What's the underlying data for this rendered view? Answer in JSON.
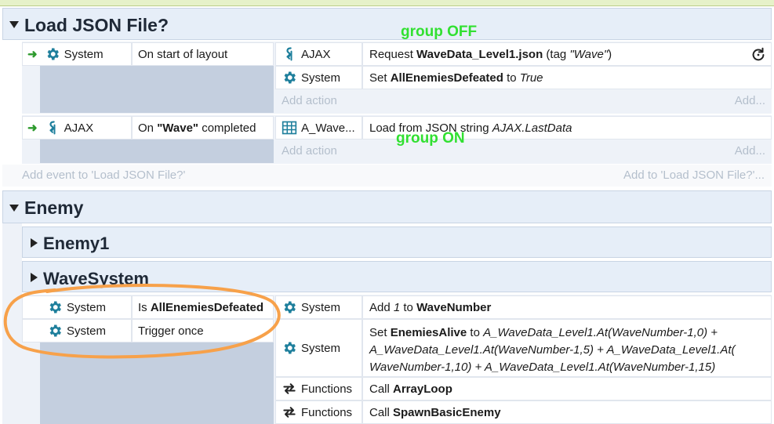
{
  "groups": {
    "load_json": {
      "title": "Load JSON File?",
      "event1": {
        "condition": {
          "object": "System",
          "text": "On start of layout"
        },
        "actions": [
          {
            "object": "AJAX",
            "prefix": "Request ",
            "bold": "WaveData_Level1.json",
            "mid": " (tag ",
            "italic": "\"Wave\"",
            "suffix": ")"
          },
          {
            "object": "System",
            "prefix": "Set ",
            "bold": "AllEnemiesDefeated",
            "mid": " to ",
            "italic": "True"
          }
        ],
        "add_action": "Add action",
        "add_short": "Add..."
      },
      "event2": {
        "condition": {
          "object": "AJAX",
          "prefix": "On ",
          "bold": "\"Wave\"",
          "suffix": " completed"
        },
        "actions": [
          {
            "object": "A_Wave...",
            "prefix": "Load from JSON string ",
            "italic": "AJAX.LastData"
          }
        ],
        "add_action": "Add action",
        "add_short": "Add..."
      },
      "add_event": "Add event to 'Load JSON File?'",
      "add_to": "Add to 'Load JSON File?'..."
    },
    "enemy": {
      "title": "Enemy",
      "sub1": "Enemy1",
      "sub2": "WaveSystem",
      "event": {
        "conditions": [
          {
            "object": "System",
            "prefix": "Is ",
            "bold": "AllEnemiesDefeated"
          },
          {
            "object": "System",
            "text": "Trigger once"
          }
        ],
        "actions": [
          {
            "object": "System",
            "prefix": "Add ",
            "italic": "1",
            "mid": " to ",
            "bold": "WaveNumber"
          },
          {
            "object": "System",
            "prefix": "Set ",
            "bold": "EnemiesAlive",
            "mid": " to ",
            "line1": "A_WaveData_Level1.At(WaveNumber-1,0) +",
            "line2": "A_WaveData_Level1.At(WaveNumber-1,5) + A_WaveData_Level1.At(",
            "line3": "WaveNumber-1,10) + A_WaveData_Level1.At(WaveNumber-1,15)"
          },
          {
            "object": "Functions",
            "prefix": "Call ",
            "bold": "ArrayLoop"
          },
          {
            "object": "Functions",
            "prefix": "Call ",
            "bold": "SpawnBasicEnemy"
          }
        ]
      }
    }
  },
  "annotations": {
    "group_off": "group OFF",
    "group_on": "group ON"
  },
  "colors": {
    "annotation_green": "#31e031",
    "circle_orange": "#f7a14a",
    "gear_teal": "#1e7f9c"
  }
}
